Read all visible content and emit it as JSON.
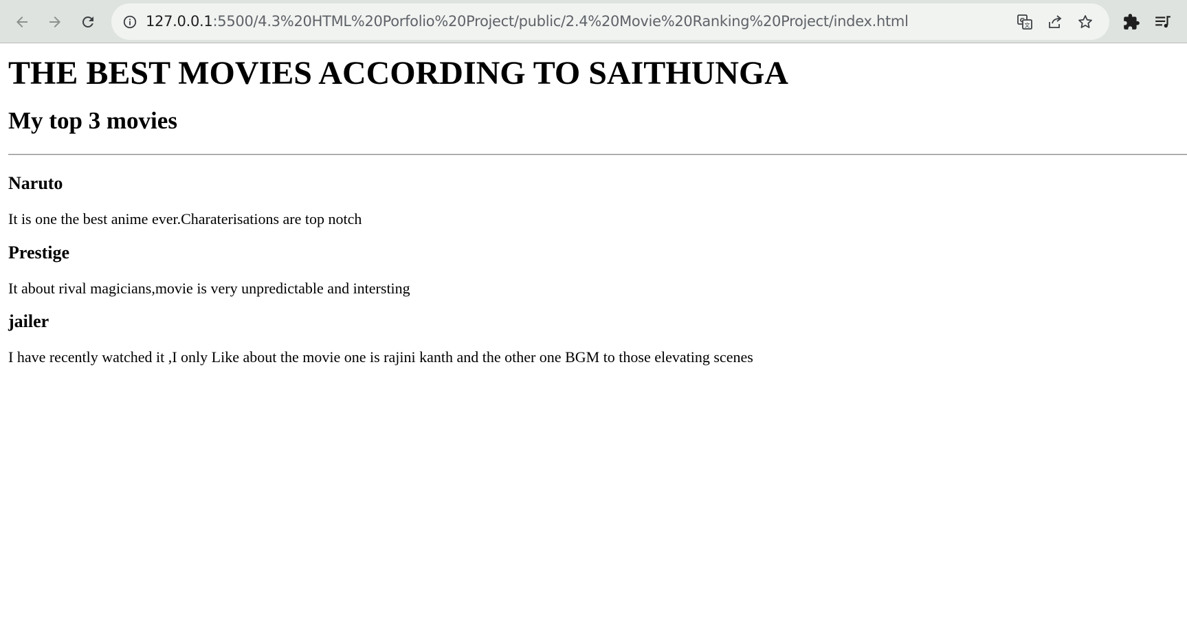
{
  "browser": {
    "url_host": "127.0.0.1",
    "url_path": ":5500/4.3%20HTML%20Porfolio%20Project/public/2.4%20Movie%20Ranking%20Project/index.html",
    "icons": {
      "back": "arrow-left-icon",
      "forward": "arrow-right-icon",
      "reload": "reload-icon",
      "site_info": "info-icon",
      "translate": "translate-icon",
      "share": "share-icon",
      "bookmark": "star-icon",
      "extensions": "puzzle-icon",
      "reading_list": "reading-list-icon"
    }
  },
  "page": {
    "title": "THE BEST MOVIES ACCORDING TO SAITHUNGA",
    "subtitle": "My top 3 movies",
    "movies": [
      {
        "name": "Naruto",
        "description": "It is one the best anime ever.Charaterisations are top notch"
      },
      {
        "name": "Prestige",
        "description": "It about rival magicians,movie is very unpredictable and intersting"
      },
      {
        "name": "jailer",
        "description": "I have recently watched it ,I only Like about the movie one is rajini kanth and the other one BGM to those elevating scenes"
      }
    ]
  },
  "colors": {
    "toolbar_bg": "#dee3df",
    "omnibox_bg": "#f1f3f1",
    "icon": "#3c4043",
    "icon_disabled": "#8c918d",
    "page_text": "#000000"
  }
}
